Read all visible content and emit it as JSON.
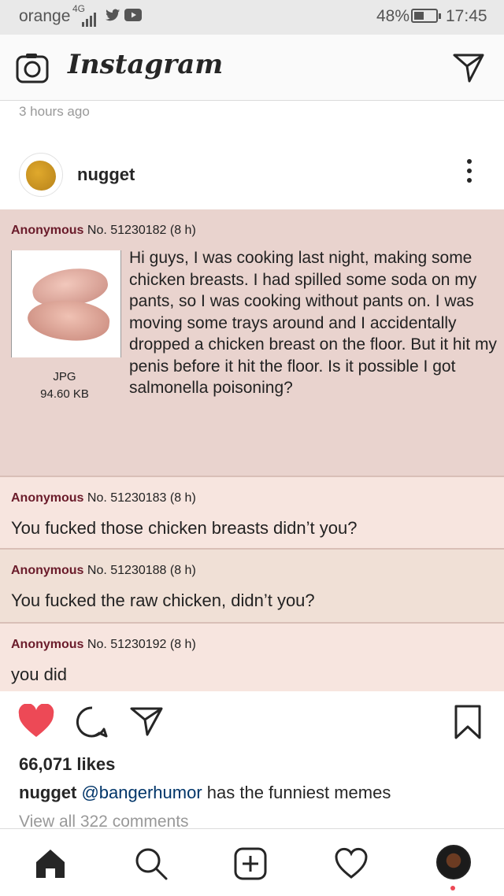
{
  "status_bar": {
    "carrier": "orange",
    "network": "4G",
    "battery_percent": "48%",
    "battery_level": 0.48,
    "time": "17:45",
    "icons": [
      "signal-icon",
      "twitter-icon",
      "youtube-icon",
      "battery-icon"
    ]
  },
  "header": {
    "logo": "Instagram",
    "icons": [
      "camera-icon",
      "direct-message-icon"
    ]
  },
  "feed": {
    "previous_post_time": "3 hours ago"
  },
  "post": {
    "username": "nugget",
    "meme": {
      "op": {
        "author": "Anonymous",
        "meta": "No. 51230182 (8 h)",
        "file_type": "JPG",
        "file_size": "94.60 KB",
        "body": "Hi guys, I was cooking last night, making some chicken breasts. I had spilled some soda on my pants, so I was cooking without pants on. I was moving some trays around and I accidentally dropped a chicken breast on the floor. But it hit my penis before it hit the floor. Is it possible I got salmonella poisoning?"
      },
      "replies": [
        {
          "author": "Anonymous",
          "meta": "No. 51230183 (8 h)",
          "body": "You fucked those chicken breasts didn’t you?"
        },
        {
          "author": "Anonymous",
          "meta": "No. 51230188 (8 h)",
          "body": "You fucked the raw chicken, didn’t you?"
        },
        {
          "author": "Anonymous",
          "meta": "No. 51230192 (8 h)",
          "body": "you did"
        }
      ]
    },
    "likes": "66,071 likes",
    "caption": {
      "user": "nugget",
      "mention": "@bangerhumor",
      "text": " has the funniest memes"
    },
    "view_comments": "View all 322 comments",
    "liked": true
  },
  "colors": {
    "like_red": "#ed4956",
    "meme_op_bg": "#e9d3ce",
    "meme_reply_bg": "#f0e0d6",
    "mention_blue": "#003569"
  }
}
